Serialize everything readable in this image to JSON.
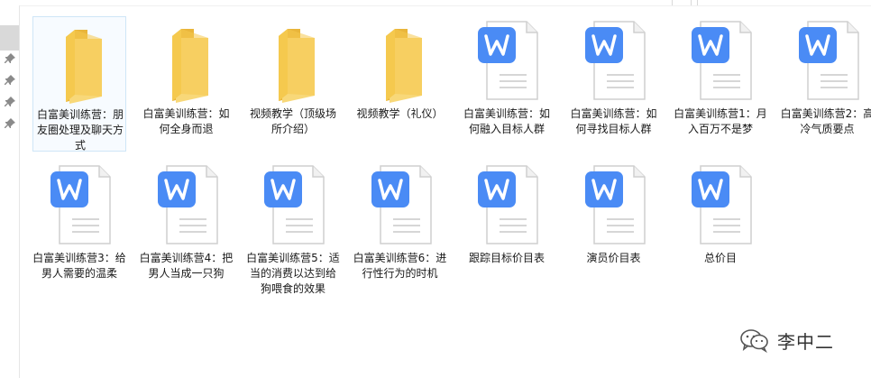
{
  "files": [
    {
      "type": "folder",
      "name": "白富美训练营：朋友圈处理及聊天方式",
      "selected": true
    },
    {
      "type": "folder",
      "name": "白富美训练营：如何全身而退"
    },
    {
      "type": "folder",
      "name": "视频教学（顶级场所介绍）"
    },
    {
      "type": "folder",
      "name": "视频教学（礼仪）"
    },
    {
      "type": "doc",
      "name": "白富美训练营：如何融入目标人群"
    },
    {
      "type": "doc",
      "name": "白富美训练营：如何寻找目标人群"
    },
    {
      "type": "doc",
      "name": "白富美训练营1：月入百万不是梦"
    },
    {
      "type": "doc",
      "name": "白富美训练营2：高冷气质要点"
    },
    {
      "type": "doc",
      "name": "白富美训练营3：给男人需要的温柔"
    },
    {
      "type": "doc",
      "name": "白富美训练营4：把男人当成一只狗"
    },
    {
      "type": "doc",
      "name": "白富美训练营5：适当的消费以达到给狗喂食的效果"
    },
    {
      "type": "doc",
      "name": "白富美训练营6：进行性行为的时机"
    },
    {
      "type": "doc",
      "name": "跟踪目标价目表"
    },
    {
      "type": "doc",
      "name": "演员价目表"
    },
    {
      "type": "doc",
      "name": "总价目"
    }
  ],
  "watermark": {
    "text": "李中二"
  },
  "colors": {
    "folder": "#f5c94e",
    "folder_dark": "#e9b53a",
    "doc_badge": "#4a8bf5",
    "selection": "#cfe6f7"
  },
  "icons": {
    "folder": "folder-icon",
    "doc": "wps-document-icon",
    "pin": "pin-icon",
    "wechat": "wechat-icon"
  }
}
